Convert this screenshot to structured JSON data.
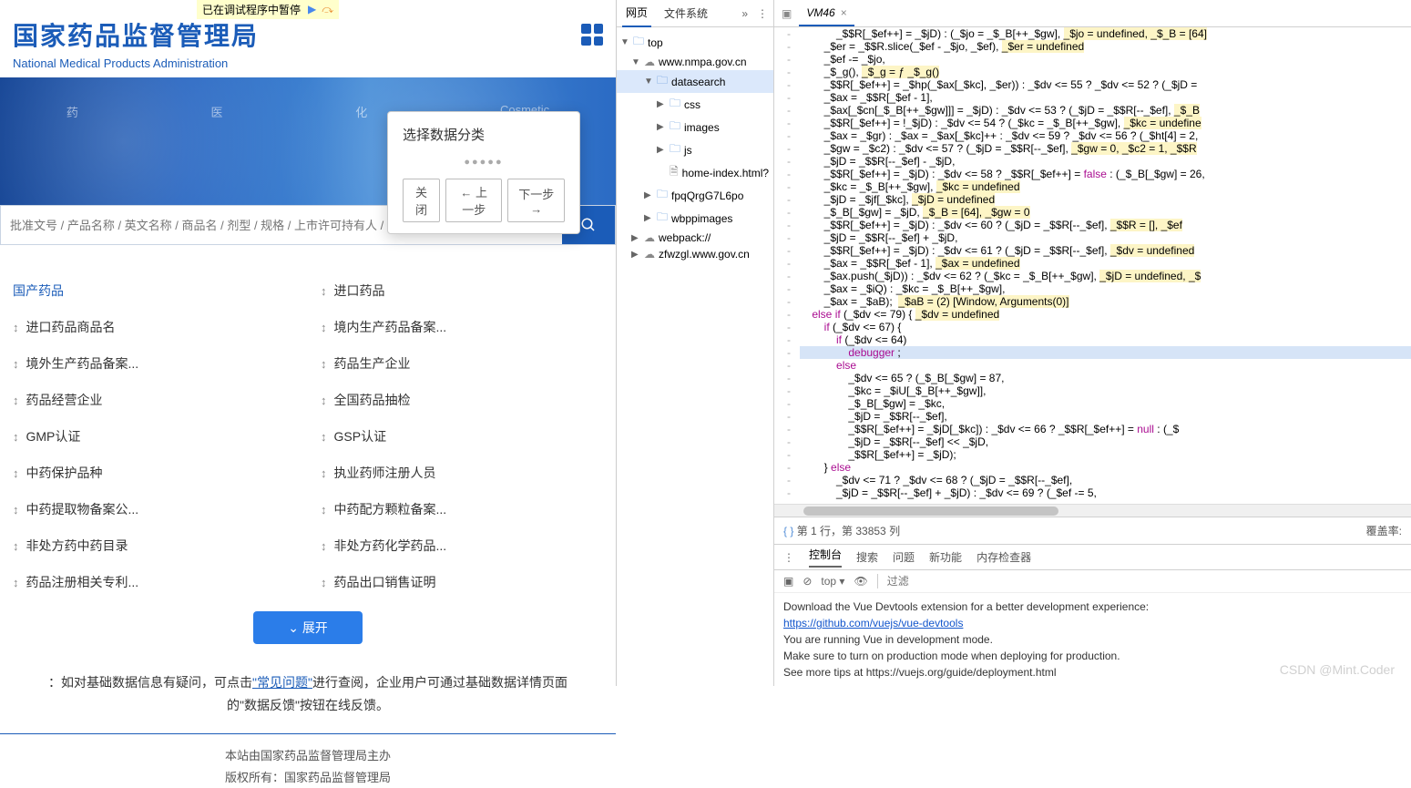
{
  "debug_banner": "已在调试程序中暂停",
  "logo": {
    "cn": "国家药品监督管理局",
    "en": "National Medical Products Administration"
  },
  "banner_tabs": [
    "药",
    "医",
    "化",
    "Cosmetic"
  ],
  "search": {
    "placeholder": "批准文号 / 产品名称 / 英文名称 / 商品名 / 剂型 / 规格 / 上市许可持有人 / 生产单位 / 产品类别 /"
  },
  "categories": [
    [
      {
        "label": "国产药品",
        "active": true
      },
      {
        "label": "进口药品"
      }
    ],
    [
      {
        "label": "进口药品商品名"
      },
      {
        "label": "境内生产药品备案..."
      }
    ],
    [
      {
        "label": "境外生产药品备案..."
      },
      {
        "label": "药品生产企业"
      }
    ],
    [
      {
        "label": "药品经营企业"
      },
      {
        "label": "全国药品抽检"
      }
    ],
    [
      {
        "label": "GMP认证"
      },
      {
        "label": "GSP认证"
      }
    ],
    [
      {
        "label": "中药保护品种"
      },
      {
        "label": "执业药师注册人员"
      }
    ],
    [
      {
        "label": "中药提取物备案公..."
      },
      {
        "label": "中药配方颗粒备案..."
      }
    ],
    [
      {
        "label": "非处方药中药目录"
      },
      {
        "label": "非处方药化学药品..."
      }
    ],
    [
      {
        "label": "药品注册相关专利..."
      },
      {
        "label": "药品出口销售证明"
      }
    ]
  ],
  "expand_btn": "展开",
  "tip": {
    "prefix": "：如对基础数据信息有疑问，可点击",
    "link": "\"常见问题\"",
    "mid": "进行查阅，企业用户可通过基础数据详情页面",
    "suffix": "的\"数据反馈\"按钮在线反馈。"
  },
  "footer": {
    "l1": "本站由国家药品监督管理局主办",
    "l2": "版权所有：国家药品监督管理局"
  },
  "modal": {
    "title": "选择数据分类",
    "dots": "●●●●●",
    "close": "关闭",
    "prev": "← 上一步",
    "next": "下一步 →"
  },
  "devtools": {
    "left_tabs": [
      "网页",
      "文件系统"
    ],
    "tree": [
      {
        "depth": 0,
        "icon": "folder",
        "label": "top",
        "open": true
      },
      {
        "depth": 1,
        "icon": "cloud",
        "label": "www.nmpa.gov.cn",
        "open": true
      },
      {
        "depth": 2,
        "icon": "folder",
        "label": "datasearch",
        "open": true,
        "selected": true
      },
      {
        "depth": 3,
        "icon": "folder",
        "label": "css",
        "open": false
      },
      {
        "depth": 3,
        "icon": "folder",
        "label": "images",
        "open": false
      },
      {
        "depth": 3,
        "icon": "folder",
        "label": "js",
        "open": false
      },
      {
        "depth": 3,
        "icon": "file",
        "label": "home-index.html?"
      },
      {
        "depth": 2,
        "icon": "folder",
        "label": "fpqQrgG7L6po",
        "open": false
      },
      {
        "depth": 2,
        "icon": "folder",
        "label": "wbppimages",
        "open": false
      },
      {
        "depth": 1,
        "icon": "cloud",
        "label": "webpack://",
        "open": false
      },
      {
        "depth": 1,
        "icon": "cloud",
        "label": "zfwzgl.www.gov.cn",
        "open": false
      }
    ],
    "file_tab": "VM46",
    "status": {
      "pos": "第 1 行，第 33853 列",
      "coverage": "覆盖率:"
    },
    "console_tabs": [
      "控制台",
      "搜索",
      "问题",
      "新功能",
      "内存检查器"
    ],
    "console_filter": "过滤",
    "console_context": "top",
    "console_msgs": [
      "Download the Vue Devtools extension for a better development experience:",
      "https://github.com/vuejs/vue-devtools",
      "",
      "You are running Vue in development mode.",
      "Make sure to turn on production mode when deploying for production.",
      "See more tips at https://vuejs.org/guide/deployment.html"
    ],
    "code": [
      "            _$$R[_$ef++] = _$jD) : (_$jo = _$_B[++_$gw], |_$jo = undefined, _$_B = [64]|",
      "        _$er = _$$R.slice(_$ef - _$jo, _$ef), |_$er = undefined|",
      "        _$ef -= _$jo,",
      "        _$_g(), |_$_g = ƒ _$_g()|",
      "        _$$R[_$ef++] = _$hp(_$ax[_$kc], _$er)) : _$dv <= 55 ? _$dv <= 52 ? (_$jD = ",
      "        _$ax = _$$R[_$ef - 1],",
      "        _$ax[_$cn[_$_B[++_$gw]]] = _$jD) : _$dv <= 53 ? (_$jD = _$$R[--_$ef], |_$_B",
      "        _$$R[_$ef++] = !_$jD) : _$dv <= 54 ? (_$kc = _$_B[++_$gw], |_$kc = undefine",
      "        _$ax = _$gr) : _$ax = _$ax[_$kc]++ : _$dv <= 59 ? _$dv <= 56 ? (_$ht[4] = 2,",
      "        _$gw = _$c2) : _$dv <= 57 ? (_$jD = _$$R[--_$ef], |_$gw = 0, _$c2 = 1, _$$R",
      "        _$jD = _$$R[--_$ef] - _$jD,",
      "        _$$R[_$ef++] = _$jD) : _$dv <= 58 ? _$$R[_$ef++] = false : (_$_B[_$gw] = 26,",
      "        _$kc = _$_B[++_$gw], |_$kc = undefined|",
      "        _$jD = _$jf[_$kc], |_$jD = undefined|",
      "        _$_B[_$gw] = _$jD, |_$_B = [64], _$gw = 0|",
      "        _$$R[_$ef++] = _$jD) : _$dv <= 60 ? (_$jD = _$$R[--_$ef], |_$$R = [], _$ef",
      "        _$jD = _$$R[--_$ef] + _$jD,",
      "        _$$R[_$ef++] = _$jD) : _$dv <= 61 ? (_$jD = _$$R[--_$ef], |_$dv = undefined",
      "        _$ax = _$$R[_$ef - 1], |_$ax = undefined|",
      "        _$ax.push(_$jD)) : _$dv <= 62 ? (_$kc = _$_B[++_$gw], |_$jD = undefined, _$",
      "        _$ax = _$iQ) : _$kc = _$_B[++_$gw],",
      "        _$ax = _$aB);  |_$aB = (2) [Window, Arguments(0)]|",
      "    else if (_$dv <= 79) { |_$dv = undefined|",
      "        if (_$dv <= 67) {",
      "            if (_$dv <= 64)",
      "                debugger ;",
      "            else",
      "                _$dv <= 65 ? (_$_B[_$gw] = 87,",
      "                _$kc = _$iU[_$_B[++_$gw]],",
      "                _$_B[_$gw] = _$kc,",
      "                _$jD = _$$R[--_$ef],",
      "                _$$R[_$ef++] = _$jD[_$kc]) : _$dv <= 66 ? _$$R[_$ef++] = null : (_$",
      "                _$jD = _$$R[--_$ef] << _$jD,",
      "                _$$R[_$ef++] = _$jD);",
      "        } else",
      "            _$dv <= 71 ? _$dv <= 68 ? (_$jD = _$$R[--_$ef],",
      "            _$jD = _$$R[--_$ef] + _$jD) : _$dv <= 69 ? (_$ef -= 5,"
    ]
  },
  "watermark": "CSDN @Mint.Coder"
}
